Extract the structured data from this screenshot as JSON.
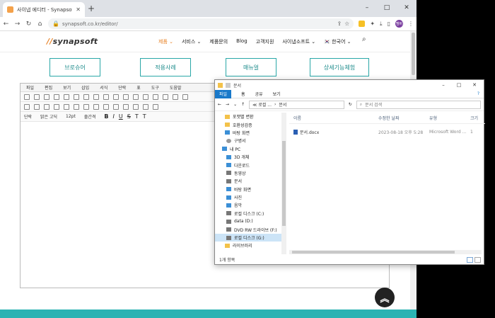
{
  "browser": {
    "tab_title": "사이냅 에디터 - Synapsoft",
    "new_tab": "+",
    "url": "synapsoft.co.kr/editor/",
    "avatar_text": "멤버",
    "win_min": "–",
    "win_max": "□",
    "win_close": "✕",
    "tab_close": "✕"
  },
  "site": {
    "logo_slash": "//",
    "logo_text": "synapsoft",
    "nav": [
      "제품 ⌄",
      "서비스 ⌄",
      "제품문의",
      "Blog",
      "고객지원",
      "사이냅소프트 ⌄",
      "🇰🇷 한국어 ⌄"
    ],
    "buttons": [
      "브로슈어",
      "적용사례",
      "매뉴얼",
      "상세기능체험"
    ]
  },
  "editor": {
    "menu": [
      "파일",
      "편집",
      "보기",
      "삽입",
      "서식",
      "단락",
      "표",
      "도구",
      "도움말"
    ],
    "para_style": "단락",
    "font": "맑은 고딕",
    "size": "12pt",
    "line_spacing": "줄간격"
  },
  "explorer": {
    "title": "문서",
    "ribbon": [
      "파일",
      "홈",
      "공유",
      "보기"
    ],
    "help": "?",
    "path": [
      "≪ 로컬 ...",
      "문서"
    ],
    "search_placeholder": "문서 검색",
    "nav_items": [
      {
        "label": "포맷별 변환",
        "icon": "folder"
      },
      {
        "label": "호환성검증",
        "icon": "folder"
      },
      {
        "label": "바탕 화면",
        "icon": "blue"
      },
      {
        "label": "구병서",
        "icon": "user"
      },
      {
        "label": "내 PC",
        "icon": "pc"
      },
      {
        "label": "3D 개체",
        "icon": "blue"
      },
      {
        "label": "다운로드",
        "icon": "blue"
      },
      {
        "label": "동영상",
        "icon": "drive"
      },
      {
        "label": "문서",
        "icon": "drive"
      },
      {
        "label": "바탕 화면",
        "icon": "blue"
      },
      {
        "label": "사진",
        "icon": "blue"
      },
      {
        "label": "음악",
        "icon": "blue"
      },
      {
        "label": "로컬 디스크 (C:)",
        "icon": "drive"
      },
      {
        "label": "data (D:)",
        "icon": "drive"
      },
      {
        "label": "DVD RW 드라이브 (F:)",
        "icon": "drive"
      },
      {
        "label": "로컬 디스크 (G:)",
        "icon": "drive",
        "selected": true
      },
      {
        "label": "라이브러리",
        "icon": "folder"
      }
    ],
    "columns": {
      "name": "이름",
      "date": "수정한 날짜",
      "type": "유형",
      "size": "크기"
    },
    "files": [
      {
        "name": "문서.docx",
        "date": "2023-08-18 오후 5:28",
        "type": "Microsoft Word ...",
        "size": "1"
      }
    ],
    "status": "1개 항목"
  }
}
